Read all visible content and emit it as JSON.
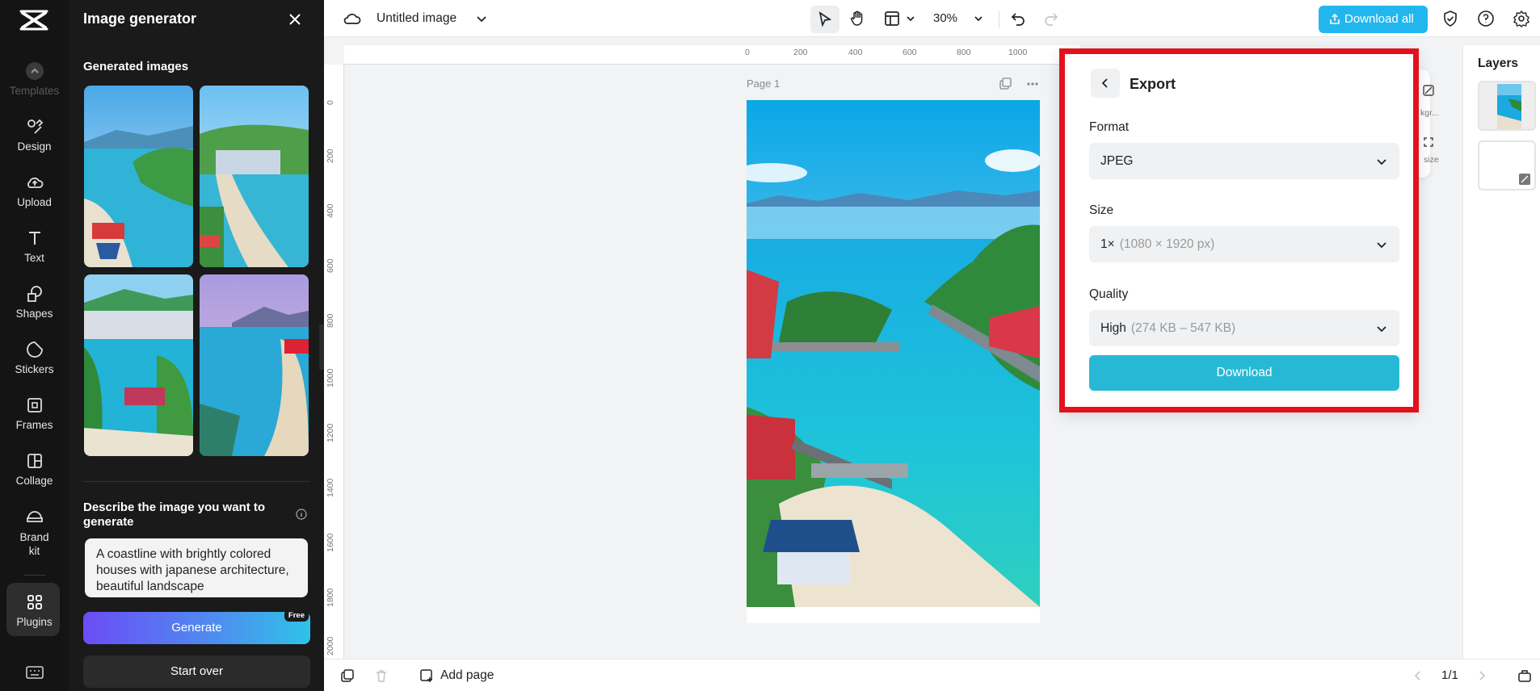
{
  "rail": {
    "items": [
      {
        "label": "Templates",
        "icon": "templates-icon"
      },
      {
        "label": "Design",
        "icon": "design-icon"
      },
      {
        "label": "Upload",
        "icon": "upload-icon"
      },
      {
        "label": "Text",
        "icon": "text-icon"
      },
      {
        "label": "Shapes",
        "icon": "shapes-icon"
      },
      {
        "label": "Stickers",
        "icon": "stickers-icon"
      },
      {
        "label": "Frames",
        "icon": "frames-icon"
      },
      {
        "label": "Collage",
        "icon": "collage-icon"
      },
      {
        "label": "Brand kit",
        "icon": "brand-kit-icon"
      },
      {
        "label": "Plugins",
        "icon": "plugins-icon"
      }
    ]
  },
  "panel": {
    "title": "Image generator",
    "subtitle": "Generated images",
    "describe_label": "Describe the image you want to generate",
    "prompt_text": "A coastline with brightly colored houses with japanese architecture, beautiful landscape",
    "generate_label": "Generate",
    "free_badge": "Free",
    "start_over_label": "Start over"
  },
  "topbar": {
    "doc_title": "Untitled image",
    "zoom": "30%",
    "download_all_label": "Download all"
  },
  "ruler": {
    "top_labels": [
      "0",
      "200",
      "400",
      "600",
      "800",
      "1000"
    ],
    "left_labels": [
      "0",
      "200",
      "400",
      "600",
      "800",
      "1000",
      "1200",
      "1400",
      "1600",
      "1800",
      "2000"
    ]
  },
  "canvas": {
    "page_label": "Page 1"
  },
  "side_card": {
    "bg_label": "kgr...",
    "size_label": "size"
  },
  "layers": {
    "title": "Layers"
  },
  "export": {
    "title": "Export",
    "format_label": "Format",
    "format_value": "JPEG",
    "size_label": "Size",
    "size_value": "1×",
    "size_detail": "(1080 × 1920 px)",
    "quality_label": "Quality",
    "quality_value": "High",
    "quality_detail": "(274 KB – 547 KB)",
    "download_label": "Download",
    "highlight_color": "#e0131d"
  },
  "bottombar": {
    "add_page_label": "Add page",
    "pager": "1/1"
  },
  "colors": {
    "accent": "#22b6ef",
    "download_button": "#27b8d6",
    "rail_bg": "#141414",
    "panel_bg": "#1a1a1a"
  }
}
